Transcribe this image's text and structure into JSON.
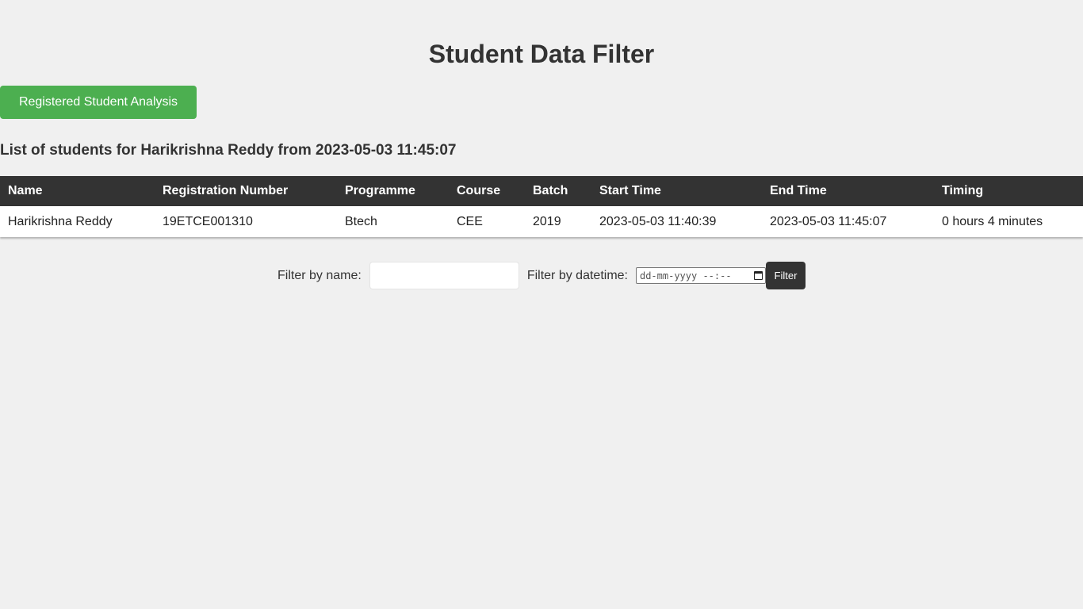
{
  "header": {
    "title": "Student Data Filter"
  },
  "toolbar": {
    "analysis_button_label": "Registered Student Analysis"
  },
  "list": {
    "heading": "List of students for Harikrishna Reddy from 2023-05-03 11:45:07"
  },
  "table": {
    "columns": [
      "Name",
      "Registration Number",
      "Programme",
      "Course",
      "Batch",
      "Start Time",
      "End Time",
      "Timing"
    ],
    "rows": [
      [
        "Harikrishna Reddy",
        "19ETCE001310",
        "Btech",
        "CEE",
        "2019",
        "2023-05-03 11:40:39",
        "2023-05-03 11:45:07",
        "0 hours 4 minutes"
      ]
    ]
  },
  "filter": {
    "name_label": "Filter by name:",
    "name_value": "",
    "datetime_label": "Filter by datetime:",
    "datetime_placeholder": "dd-mm-yyyy --:--",
    "button_label": "Filter"
  },
  "colors": {
    "accent_green": "#4caf50",
    "dark": "#333333",
    "background": "#f0f0f0"
  }
}
